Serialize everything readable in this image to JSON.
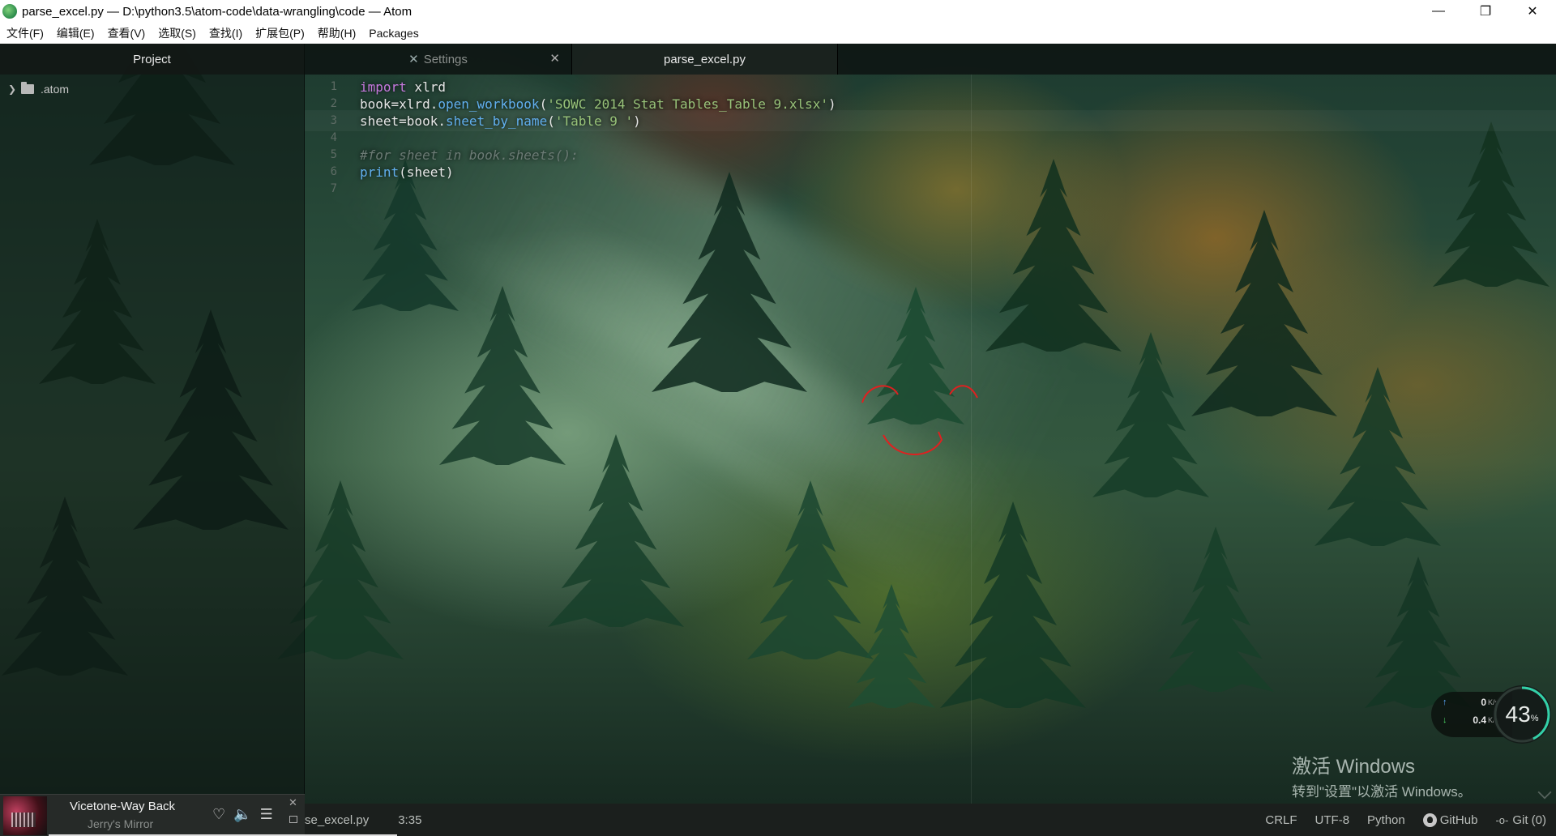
{
  "window": {
    "title": "parse_excel.py — D:\\python3.5\\atom-code\\data-wrangling\\code — Atom",
    "controls": {
      "minimize": "—",
      "restore": "❐",
      "close": "✕"
    }
  },
  "menu": [
    "文件(F)",
    "编辑(E)",
    "查看(V)",
    "选取(S)",
    "查找(I)",
    "扩展包(P)",
    "帮助(H)",
    "Packages"
  ],
  "project": {
    "header": "Project",
    "items": [
      {
        "name": ".atom",
        "type": "folder",
        "expanded": false
      }
    ]
  },
  "tabs": [
    {
      "label": "Settings",
      "icon": "settings-icon",
      "closable": true,
      "active": false
    },
    {
      "label": "parse_excel.py",
      "active": true
    }
  ],
  "editor": {
    "lines": [
      {
        "num": "1",
        "tokens": [
          {
            "t": "import",
            "c": "kw"
          },
          {
            "t": " xlrd",
            "c": "pl"
          }
        ]
      },
      {
        "num": "2",
        "tokens": [
          {
            "t": "book=xlrd.",
            "c": "pl"
          },
          {
            "t": "open_workbook",
            "c": "fn"
          },
          {
            "t": "(",
            "c": "pl"
          },
          {
            "t": "'SOWC 2014 Stat Tables_Table 9.xlsx'",
            "c": "str"
          },
          {
            "t": ")",
            "c": "pl"
          }
        ]
      },
      {
        "num": "3",
        "tokens": [
          {
            "t": "sheet=book.",
            "c": "pl"
          },
          {
            "t": "sheet_by_name",
            "c": "fn"
          },
          {
            "t": "(",
            "c": "pl"
          },
          {
            "t": "'Table 9 '",
            "c": "str"
          },
          {
            "t": ")",
            "c": "pl"
          }
        ],
        "cursor": true
      },
      {
        "num": "4",
        "tokens": []
      },
      {
        "num": "5",
        "tokens": [
          {
            "t": "#for sheet in book.sheets():",
            "c": "cm"
          }
        ]
      },
      {
        "num": "6",
        "tokens": [
          {
            "t": "print",
            "c": "fn"
          },
          {
            "t": "(sheet)",
            "c": "pl"
          }
        ]
      },
      {
        "num": "7",
        "tokens": []
      }
    ]
  },
  "status": {
    "file": "se_excel.py",
    "cursor_pos": "3:35",
    "line_ending": "CRLF",
    "encoding": "UTF-8",
    "grammar": "Python",
    "github": "GitHub",
    "git": "Git (0)"
  },
  "music": {
    "song": "Vicetone-Way Back",
    "artist": "Jerry's Mirror",
    "icons": [
      "heart-icon",
      "volume-icon",
      "playlist-icon"
    ]
  },
  "netwidget": {
    "upload": "0",
    "download": "0.4",
    "unit": "K/s",
    "cpu": "43",
    "cpu_unit": "%"
  },
  "watermark": {
    "line1": "激活 Windows",
    "line2": "转到\"设置\"以激活 Windows。"
  },
  "colors": {
    "keyword": "#c678dd",
    "function": "#61afef",
    "string": "#98c379",
    "comment": "#6b7a74",
    "smiley": "#e02020"
  }
}
